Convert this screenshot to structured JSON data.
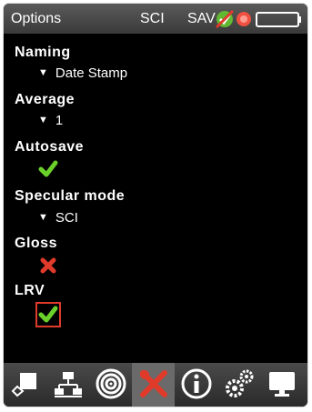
{
  "statusbar": {
    "title": "Options",
    "measurement_mode": "SCI",
    "save_indicator": "SAV",
    "icons": [
      "usb-connected-icon",
      "record-indicator-icon",
      "battery-icon"
    ]
  },
  "settings": {
    "naming": {
      "label": "Naming",
      "value": "Date Stamp"
    },
    "average": {
      "label": "Average",
      "value": "1"
    },
    "autosave": {
      "label": "Autosave",
      "enabled": true
    },
    "specular_mode": {
      "label": "Specular mode",
      "value": "SCI"
    },
    "gloss": {
      "label": "Gloss",
      "enabled": false
    },
    "lrv": {
      "label": "LRV",
      "enabled": true
    }
  },
  "toolbar": {
    "buttons": [
      "standards-icon",
      "network-icon",
      "target-icon",
      "tools-icon",
      "info-icon",
      "settings-gear-icon",
      "monitor-icon"
    ],
    "active": "tools-icon"
  },
  "colors": {
    "check_green": "#6bd12a",
    "cross_red": "#e03a2a",
    "background": "#000000"
  }
}
